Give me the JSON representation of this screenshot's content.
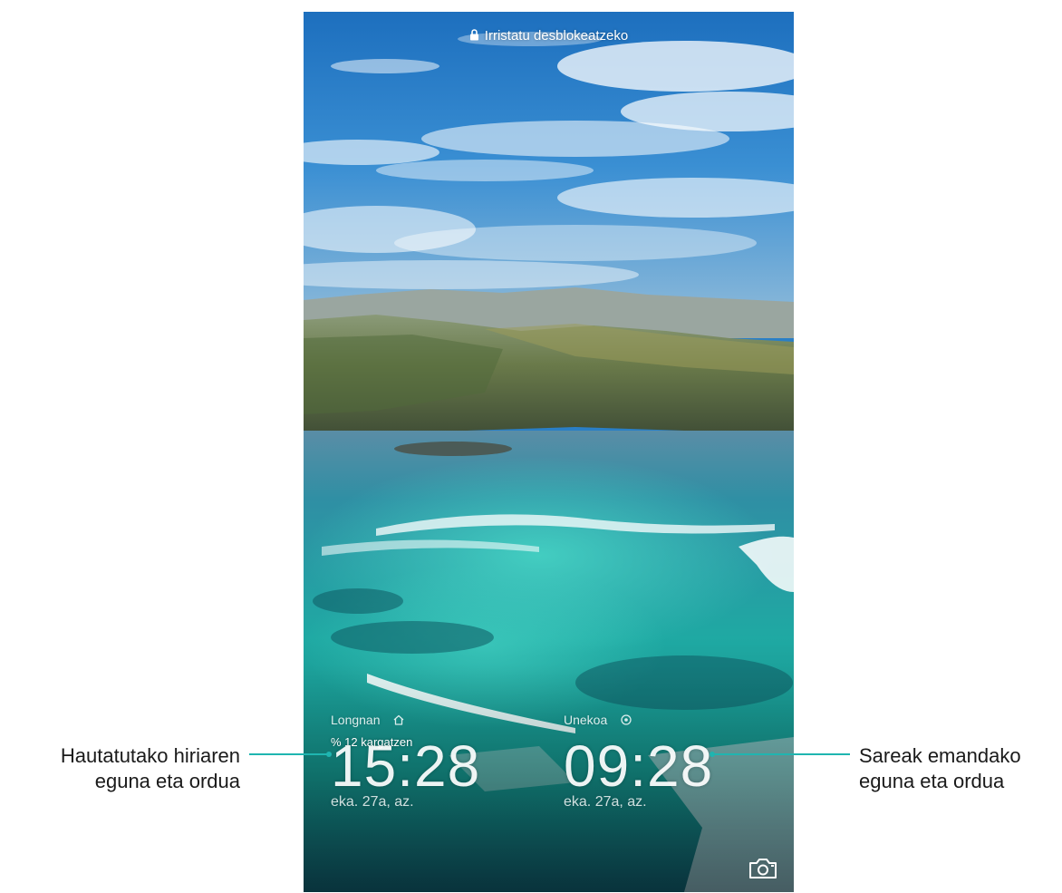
{
  "lockscreen": {
    "unlock_hint": "Irristatu desblokeatzeko",
    "charging_status": "% 12 kargatzen",
    "home_clock": {
      "city": "Longnan",
      "time": "15:28",
      "date": "eka. 27a, az.",
      "icon": "home-icon"
    },
    "network_clock": {
      "city": "Unekoa",
      "time": "09:28",
      "date": "eka. 27a, az.",
      "icon": "location-icon"
    },
    "camera_icon": "camera-icon"
  },
  "callouts": {
    "left": {
      "line1": "Hautatutako hiriaren",
      "line2": "eguna eta ordua"
    },
    "right": {
      "line1": "Sareak emandako",
      "line2": "eguna eta ordua"
    }
  },
  "colors": {
    "callout_accent": "#1fb5b0",
    "sky": "#2a7fc6",
    "lagoon": "#1fa7a0"
  }
}
